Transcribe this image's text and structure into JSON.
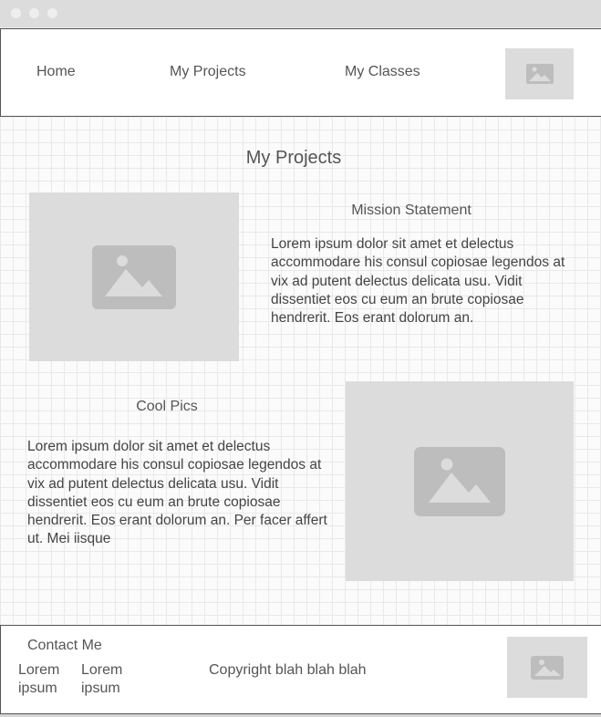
{
  "window": {
    "title_dots": [
      "close",
      "minimize",
      "maximize"
    ]
  },
  "nav": {
    "items": [
      {
        "label": "Home"
      },
      {
        "label": "My Projects"
      },
      {
        "label": "My Classes"
      }
    ],
    "logo_icon": "image-placeholder-icon"
  },
  "main": {
    "title": "My Projects",
    "sections": [
      {
        "heading": "Mission Statement",
        "text": "Lorem ipsum dolor sit amet et delectus accommodare his consul copiosae legendos at vix ad putent delectus delicata usu. Vidit dissentiet eos cu eum an brute copiosae hendrerit. Eos erant dolorum an.",
        "image_icon": "image-placeholder-icon"
      },
      {
        "heading": "Cool Pics",
        "text": "Lorem ipsum dolor sit amet et delectus accommodare his consul copiosae legendos at vix ad putent delectus delicata usu. Vidit dissentiet eos cu eum an brute copiosae hendrerit. Eos erant dolorum an. Per facer affert ut. Mei iisque",
        "image_icon": "image-placeholder-icon"
      }
    ]
  },
  "footer": {
    "contact_label": "Contact Me",
    "col1": "Lorem ipsum",
    "col2": "Lorem ipsum",
    "copyright": "Copyright blah blah blah",
    "image_icon": "image-placeholder-icon"
  },
  "colors": {
    "placeholder_bg": "#dcdcdc",
    "placeholder_icon": "#bdbdbd",
    "border": "#555555",
    "grid": "#e9e9e9"
  }
}
